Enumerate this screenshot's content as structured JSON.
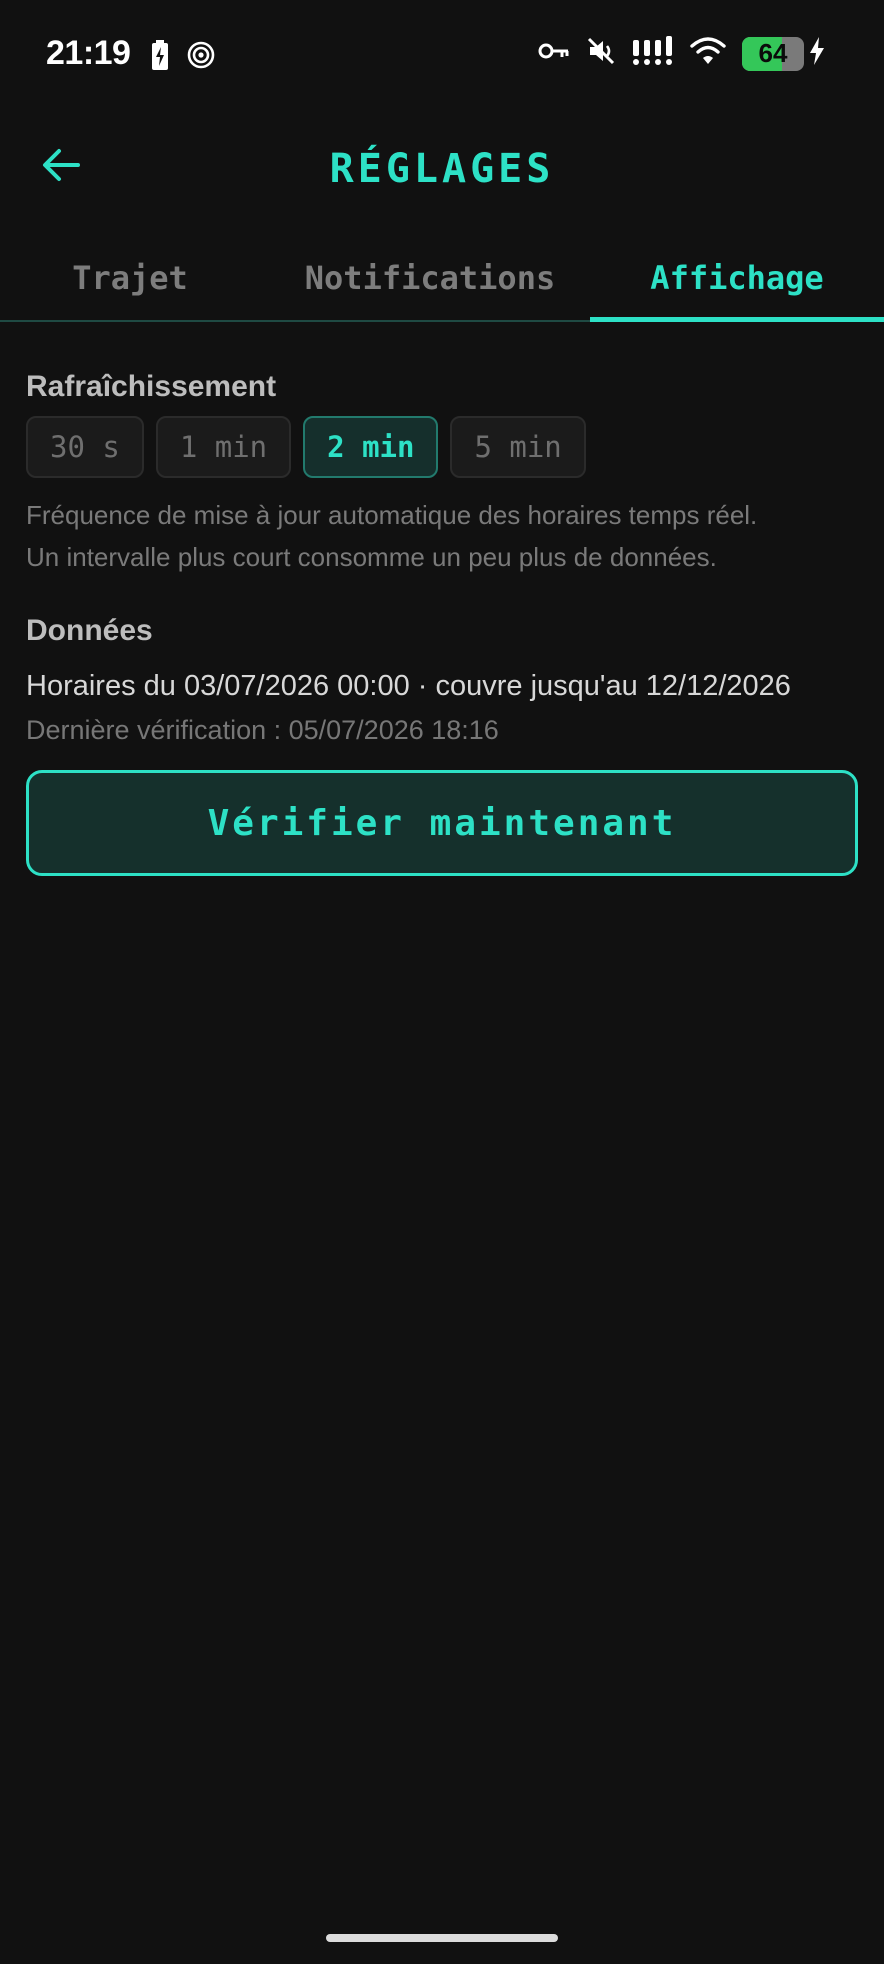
{
  "status_bar": {
    "time": "21:19",
    "battery_level": "64",
    "battery_fraction": 0.64,
    "icons_left": [
      "battery-charging-icon",
      "hotspot-icon"
    ],
    "icons_right": [
      "vpn-key-icon",
      "mute-icon",
      "signal-icon",
      "wifi-icon",
      "battery-icon",
      "charging-bolt-icon"
    ]
  },
  "header": {
    "back_icon": "arrow-left-icon",
    "title": "RÉGLAGES"
  },
  "tabs": [
    {
      "label": "Trajet",
      "active": false
    },
    {
      "label": "Notifications",
      "active": false
    },
    {
      "label": "Affichage",
      "active": true
    }
  ],
  "refresh": {
    "title": "Rafraîchissement",
    "options": [
      "30 s",
      "1 min",
      "2 min",
      "5 min"
    ],
    "selected": "2 min",
    "help_line1": "Fréquence de mise à jour automatique des horaires temps réel.",
    "help_line2": "Un intervalle plus court consomme un peu plus de données."
  },
  "data_section": {
    "title": "Données",
    "schedule_info": "Horaires du 03/07/2026 00:00 · couvre jusqu'au 12/12/2026",
    "last_check": "Dernière vérification : 05/07/2026 18:16",
    "verify_button": "Vérifier maintenant"
  },
  "colors": {
    "accent": "#2de1c6",
    "background": "#111111",
    "battery": "#34c759"
  }
}
